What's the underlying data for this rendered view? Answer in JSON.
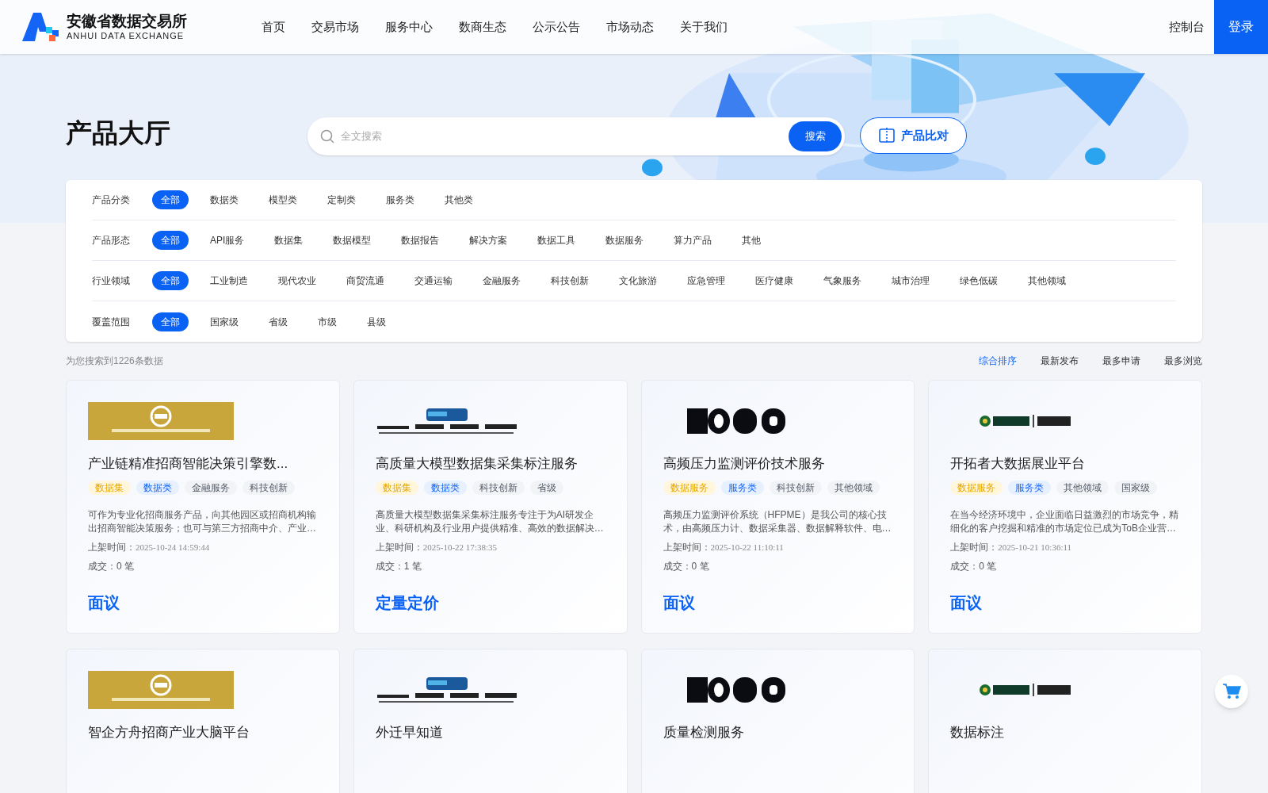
{
  "header": {
    "logo_title": "安徽省数据交易所",
    "logo_subtitle": "ANHUI DATA EXCHANGE",
    "nav": [
      "首页",
      "交易市场",
      "服务中心",
      "数商生态",
      "公示公告",
      "市场动态",
      "关于我们"
    ],
    "console": "控制台",
    "login": "登录"
  },
  "hero": {
    "title": "产品大厅",
    "search": {
      "placeholder": "全文搜索"
    },
    "search_button": "搜索",
    "compare_button": "产品比对"
  },
  "filters": [
    {
      "label": "产品分类",
      "options": [
        {
          "label": "全部",
          "selected": true
        },
        {
          "label": "数据类",
          "selected": false
        },
        {
          "label": "模型类",
          "selected": false
        },
        {
          "label": "定制类",
          "selected": false
        },
        {
          "label": "服务类",
          "selected": false
        },
        {
          "label": "其他类",
          "selected": false
        }
      ]
    },
    {
      "label": "产品形态",
      "options": [
        {
          "label": "全部",
          "selected": true
        },
        {
          "label": "API服务",
          "selected": false
        },
        {
          "label": "数据集",
          "selected": false
        },
        {
          "label": "数据模型",
          "selected": false
        },
        {
          "label": "数据报告",
          "selected": false
        },
        {
          "label": "解决方案",
          "selected": false
        },
        {
          "label": "数据工具",
          "selected": false
        },
        {
          "label": "数据服务",
          "selected": false
        },
        {
          "label": "算力产品",
          "selected": false
        },
        {
          "label": "其他",
          "selected": false
        }
      ]
    },
    {
      "label": "行业领域",
      "options": [
        {
          "label": "全部",
          "selected": true
        },
        {
          "label": "工业制造",
          "selected": false
        },
        {
          "label": "现代农业",
          "selected": false
        },
        {
          "label": "商贸流通",
          "selected": false
        },
        {
          "label": "交通运输",
          "selected": false
        },
        {
          "label": "金融服务",
          "selected": false
        },
        {
          "label": "科技创新",
          "selected": false
        },
        {
          "label": "文化旅游",
          "selected": false
        },
        {
          "label": "应急管理",
          "selected": false
        },
        {
          "label": "医疗健康",
          "selected": false
        },
        {
          "label": "气象服务",
          "selected": false
        },
        {
          "label": "城市治理",
          "selected": false
        },
        {
          "label": "绿色低碳",
          "selected": false
        },
        {
          "label": "其他领域",
          "selected": false
        }
      ]
    },
    {
      "label": "覆盖范围",
      "options": [
        {
          "label": "全部",
          "selected": true
        },
        {
          "label": "国家级",
          "selected": false
        },
        {
          "label": "省级",
          "selected": false
        },
        {
          "label": "市级",
          "selected": false
        },
        {
          "label": "县级",
          "selected": false
        }
      ]
    }
  ],
  "results": {
    "count": "为您搜索到1226条数据",
    "sort": [
      {
        "label": "综合排序",
        "selected": true
      },
      {
        "label": "最新发布",
        "selected": false
      },
      {
        "label": "最多申请",
        "selected": false
      },
      {
        "label": "最多浏览",
        "selected": false
      }
    ]
  },
  "products": [
    {
      "title": "产业链精准招商智能决策引擎数...",
      "tags": [
        {
          "label": "数据集",
          "kind": "form"
        },
        {
          "label": "数据类",
          "kind": "category"
        },
        {
          "label": "金融服务",
          "kind": "other"
        },
        {
          "label": "科技创新",
          "kind": "other"
        }
      ],
      "description": "可作为专业化招商服务产品，向其他园区或招商机构输出招商智能决策服务；也可与第三方招商中介、产业…",
      "listed_label": "上架时间：",
      "listed": "2025-10-24 14:59:44",
      "deals_label": "成交：",
      "deals": "0 笔",
      "price": "面议"
    },
    {
      "title": "高质量大模型数据集采集标注服务",
      "tags": [
        {
          "label": "数据集",
          "kind": "form"
        },
        {
          "label": "数据类",
          "kind": "category"
        },
        {
          "label": "科技创新",
          "kind": "other"
        },
        {
          "label": "省级",
          "kind": "other"
        }
      ],
      "description": "高质量大模型数据集采集标注服务专注于为AI研发企业、科研机构及行业用户提供精准、高效的数据解决…",
      "listed_label": "上架时间：",
      "listed": "2025-10-22 17:38:35",
      "deals_label": "成交：",
      "deals": "1 笔",
      "price": "定量定价"
    },
    {
      "title": "高频压力监测评价技术服务",
      "tags": [
        {
          "label": "数据服务",
          "kind": "form"
        },
        {
          "label": "服务类",
          "kind": "category"
        },
        {
          "label": "科技创新",
          "kind": "other"
        },
        {
          "label": "其他领域",
          "kind": "other"
        }
      ],
      "description": "高频压力监测评价系统（HFPME）是我公司的核心技术，由高频压力计、数据采集器、数据解释软件、电…",
      "listed_label": "上架时间：",
      "listed": "2025-10-22 11:10:11",
      "deals_label": "成交：",
      "deals": "0 笔",
      "price": "面议"
    },
    {
      "title": "开拓者大数据展业平台",
      "tags": [
        {
          "label": "数据服务",
          "kind": "form"
        },
        {
          "label": "服务类",
          "kind": "category"
        },
        {
          "label": "其他领域",
          "kind": "other"
        },
        {
          "label": "国家级",
          "kind": "other"
        }
      ],
      "description": "在当今经济环境中，企业面临日益激烈的市场竞争，精细化的客户挖掘和精准的市场定位已成为ToB企业营…",
      "listed_label": "上架时间：",
      "listed": "2025-10-21 10:36:11",
      "deals_label": "成交：",
      "deals": "0 笔",
      "price": "面议"
    },
    {
      "title": "智企方舟招商产业大脑平台"
    },
    {
      "title": "外迁早知道"
    },
    {
      "title": "质量检测服务"
    },
    {
      "title": "数据标注"
    }
  ]
}
